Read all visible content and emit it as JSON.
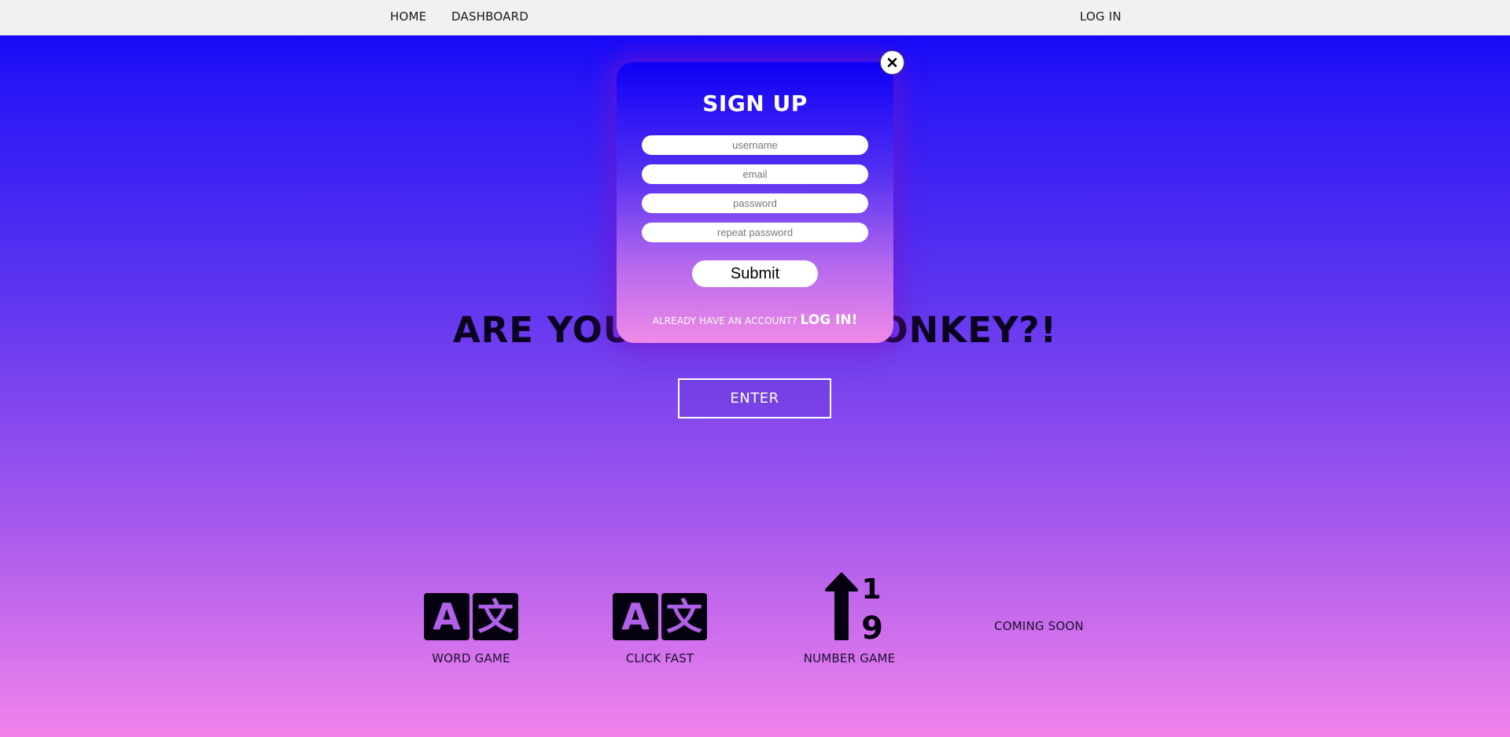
{
  "nav": {
    "home": "HOME",
    "dashboard": "DASHBOARD",
    "login": "LOG IN"
  },
  "hero": {
    "title": "ARE YOU A SMART MONKEY?!",
    "enter_label": "ENTER"
  },
  "games": [
    {
      "label": "WORD GAME",
      "icon": "translate-icon"
    },
    {
      "label": "CLICK FAST",
      "icon": "translate-icon"
    },
    {
      "label": "NUMBER GAME",
      "icon": "sort-numeric-up-icon"
    },
    {
      "label": "COMING SOON"
    }
  ],
  "icon_glyphs": {
    "translate_left": "A",
    "translate_right": "文",
    "number_top": "1",
    "number_bottom": "9"
  },
  "modal": {
    "title": "SIGN UP",
    "fields": {
      "username_placeholder": "username",
      "email_placeholder": "email",
      "password_placeholder": "password",
      "repeat_password_placeholder": "repeat password"
    },
    "submit_label": "Submit",
    "footer_text": "ALREADY HAVE AN ACCOUNT?",
    "footer_link": "LOG IN!",
    "close_icon": "close-icon"
  },
  "colors": {
    "gradient_top": "#0a00f7",
    "gradient_bottom": "#f283ec",
    "icon_fill": "#050110",
    "icon_glyph": "#b061e8",
    "navbar_bg": "#f1f1f1"
  }
}
